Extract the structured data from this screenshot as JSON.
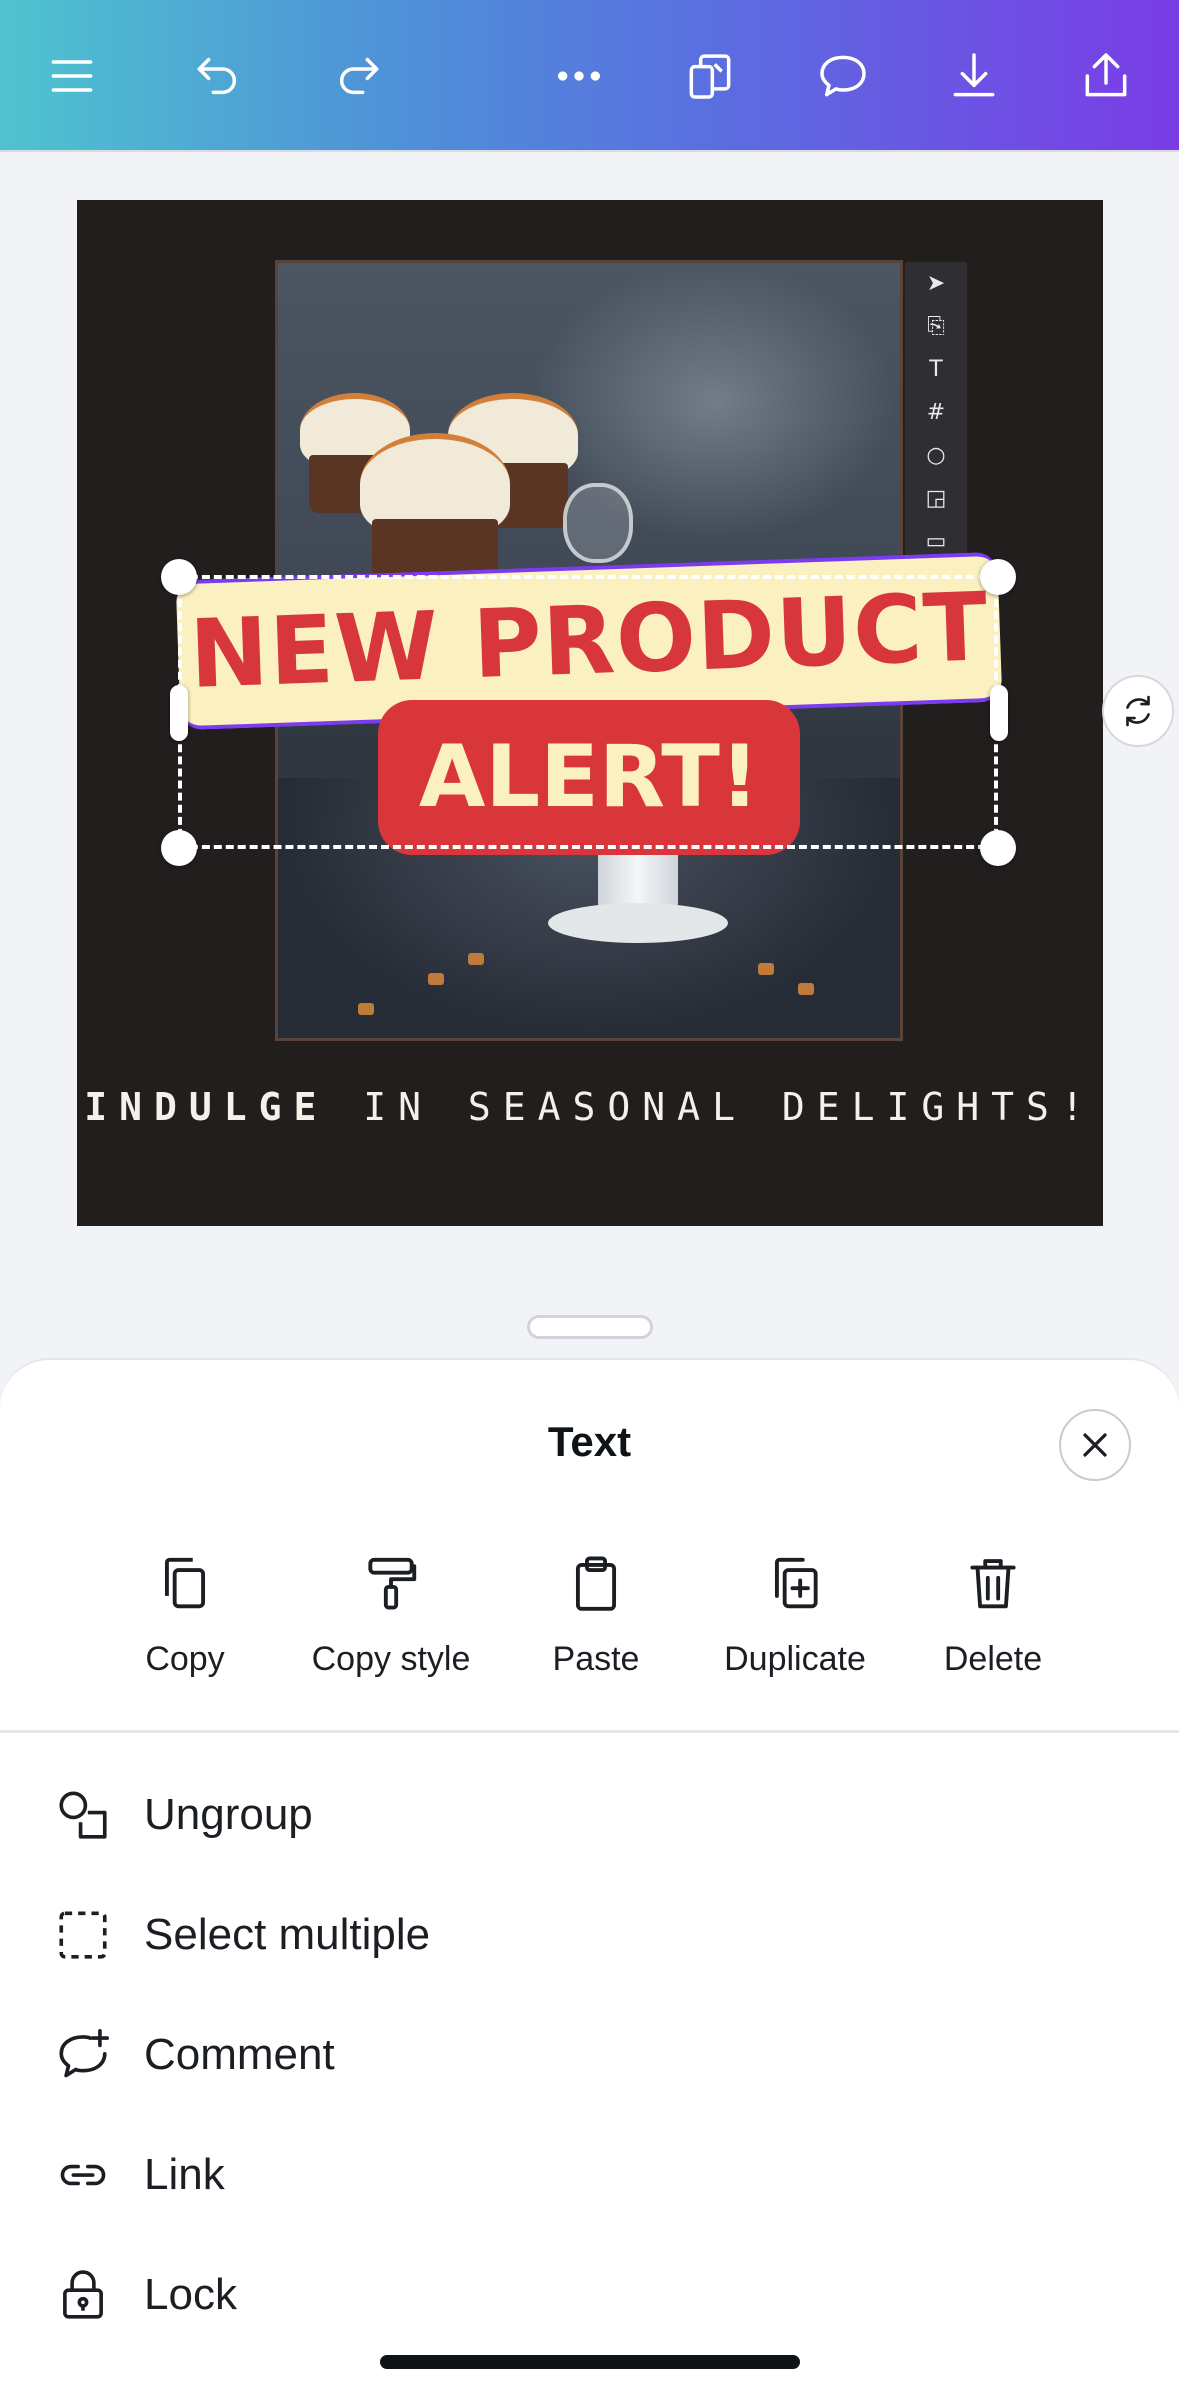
{
  "toolbar": {
    "icons": [
      "menu-icon",
      "undo-icon",
      "redo-icon",
      "more-icon",
      "pages-icon",
      "comment-icon",
      "download-icon",
      "share-icon"
    ]
  },
  "design": {
    "headline_line1": "NEW PRODUCT",
    "headline_line2": "ALERT!",
    "tagline_bold": "INDULGE",
    "tagline_rest": " IN SEASONAL DELIGHTS!",
    "tool_strip": [
      "➤",
      "⎘",
      "T",
      "#",
      "○",
      "◲",
      "▭"
    ],
    "colors": {
      "background": "#221e1e",
      "banner_light": "#fbf0c0",
      "banner_red": "#d9363b",
      "selection_accent": "#7b3cf0"
    }
  },
  "sheet": {
    "title": "Text",
    "actions": [
      {
        "label": "Copy",
        "icon": "copy-icon"
      },
      {
        "label": "Copy style",
        "icon": "paint-roller-icon"
      },
      {
        "label": "Paste",
        "icon": "clipboard-icon"
      },
      {
        "label": "Duplicate",
        "icon": "duplicate-icon"
      },
      {
        "label": "Delete",
        "icon": "trash-icon"
      }
    ],
    "menu": [
      {
        "label": "Ungroup",
        "icon": "ungroup-icon"
      },
      {
        "label": "Select multiple",
        "icon": "select-multiple-icon"
      },
      {
        "label": "Comment",
        "icon": "comment-add-icon"
      },
      {
        "label": "Link",
        "icon": "link-icon"
      },
      {
        "label": "Lock",
        "icon": "lock-icon"
      }
    ]
  }
}
